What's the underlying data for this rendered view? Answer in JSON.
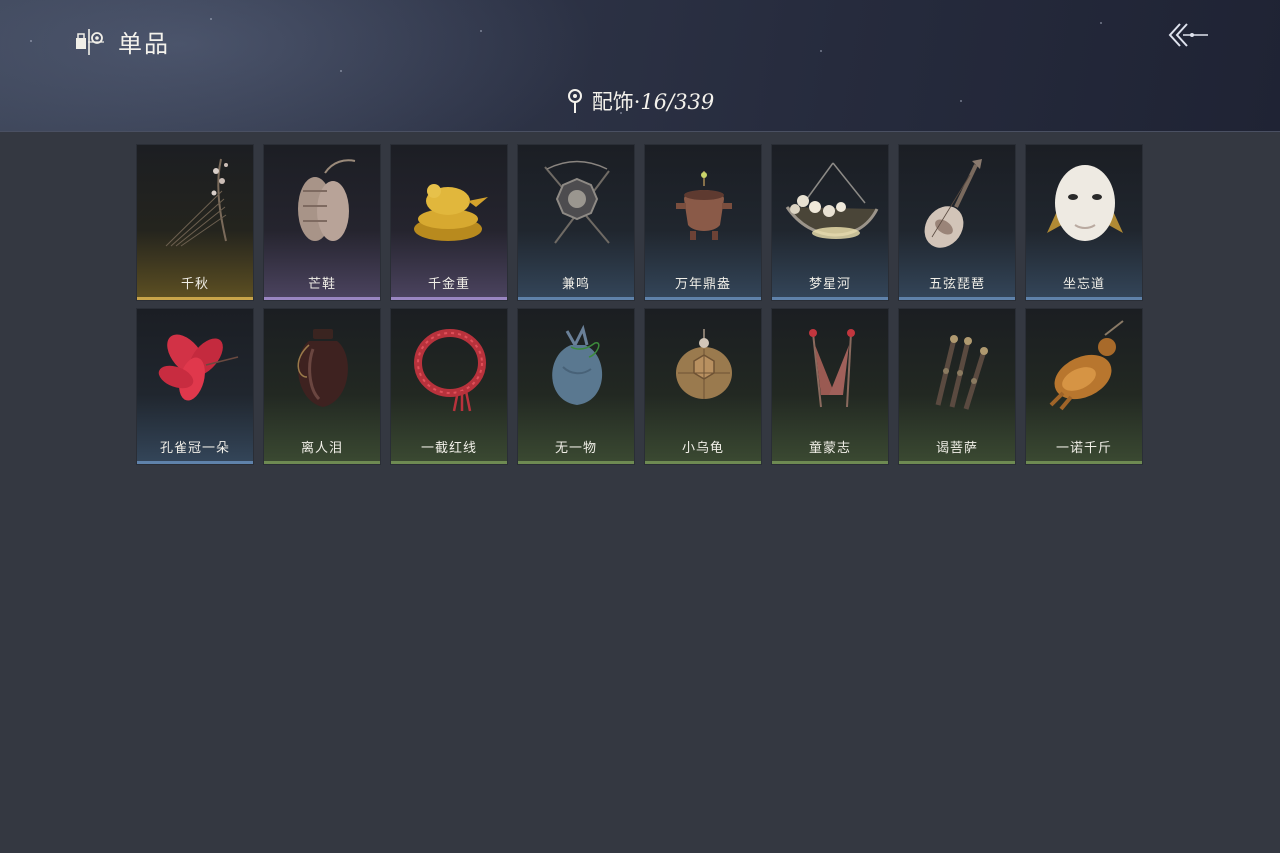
{
  "header": {
    "title": "单品",
    "title_icon": "item-collection-icon",
    "back_icon": "double-chevron-back-icon",
    "category_icon": "location-pin-icon",
    "category": "配饰",
    "separator": "·",
    "count": "16/339"
  },
  "items": [
    {
      "name": "千秋",
      "rarity": "gold",
      "icon": "branch-instrument-icon"
    },
    {
      "name": "芒鞋",
      "rarity": "purple",
      "icon": "straw-sandals-icon"
    },
    {
      "name": "千金重",
      "rarity": "purple",
      "icon": "golden-bird-icon"
    },
    {
      "name": "兼鸣",
      "rarity": "blue",
      "icon": "octagon-drum-icon"
    },
    {
      "name": "万年鼎盎",
      "rarity": "blue",
      "icon": "bronze-vessel-icon"
    },
    {
      "name": "梦星河",
      "rarity": "blue",
      "icon": "flower-boat-icon"
    },
    {
      "name": "五弦琵琶",
      "rarity": "blue",
      "icon": "pipa-icon"
    },
    {
      "name": "坐忘道",
      "rarity": "blue",
      "icon": "white-mask-icon"
    },
    {
      "name": "孔雀冠一朵",
      "rarity": "blue",
      "icon": "red-flower-icon"
    },
    {
      "name": "离人泪",
      "rarity": "green",
      "icon": "wine-jar-icon"
    },
    {
      "name": "一截红线",
      "rarity": "green",
      "icon": "red-rope-icon"
    },
    {
      "name": "无一物",
      "rarity": "green",
      "icon": "cloth-bag-icon"
    },
    {
      "name": "小乌龟",
      "rarity": "green",
      "icon": "turtle-icon"
    },
    {
      "name": "童蒙志",
      "rarity": "green",
      "icon": "twin-banners-icon"
    },
    {
      "name": "谒菩萨",
      "rarity": "green",
      "icon": "prayer-beads-icon"
    },
    {
      "name": "一诺千斤",
      "rarity": "green",
      "icon": "roast-chicken-icon"
    }
  ]
}
